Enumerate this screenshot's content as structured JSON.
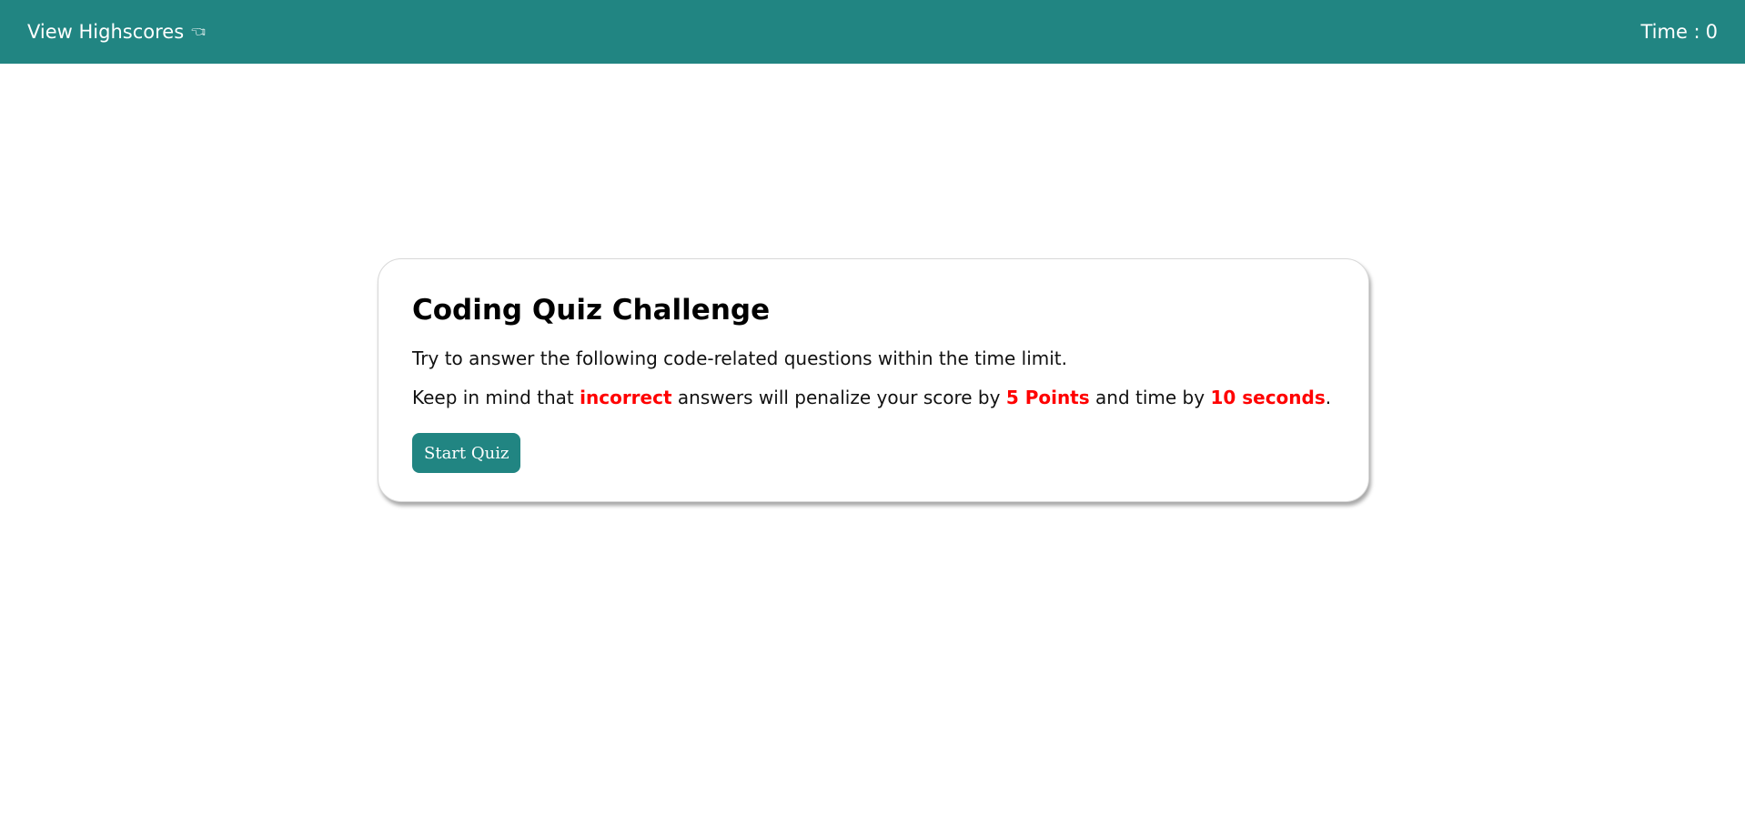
{
  "header": {
    "highscores_label": "View Highscores",
    "highscores_icon": "pointing-hand-icon",
    "timer_label": "Time :",
    "timer_value": "0",
    "background_color": "#218582"
  },
  "quiz_intro": {
    "title": "Coding Quiz Challenge",
    "instructions": "Try to answer the following code-related questions within the time limit.",
    "penalty": {
      "prefix": "Keep in mind that ",
      "incorrect_word": "incorrect",
      "middle": " answers will penalize your score by ",
      "points": "5 Points",
      "conjunction": " and time by ",
      "seconds": "10 seconds",
      "suffix": "."
    },
    "start_button_label": "Start Quiz",
    "highlight_color": "#ff0000"
  }
}
